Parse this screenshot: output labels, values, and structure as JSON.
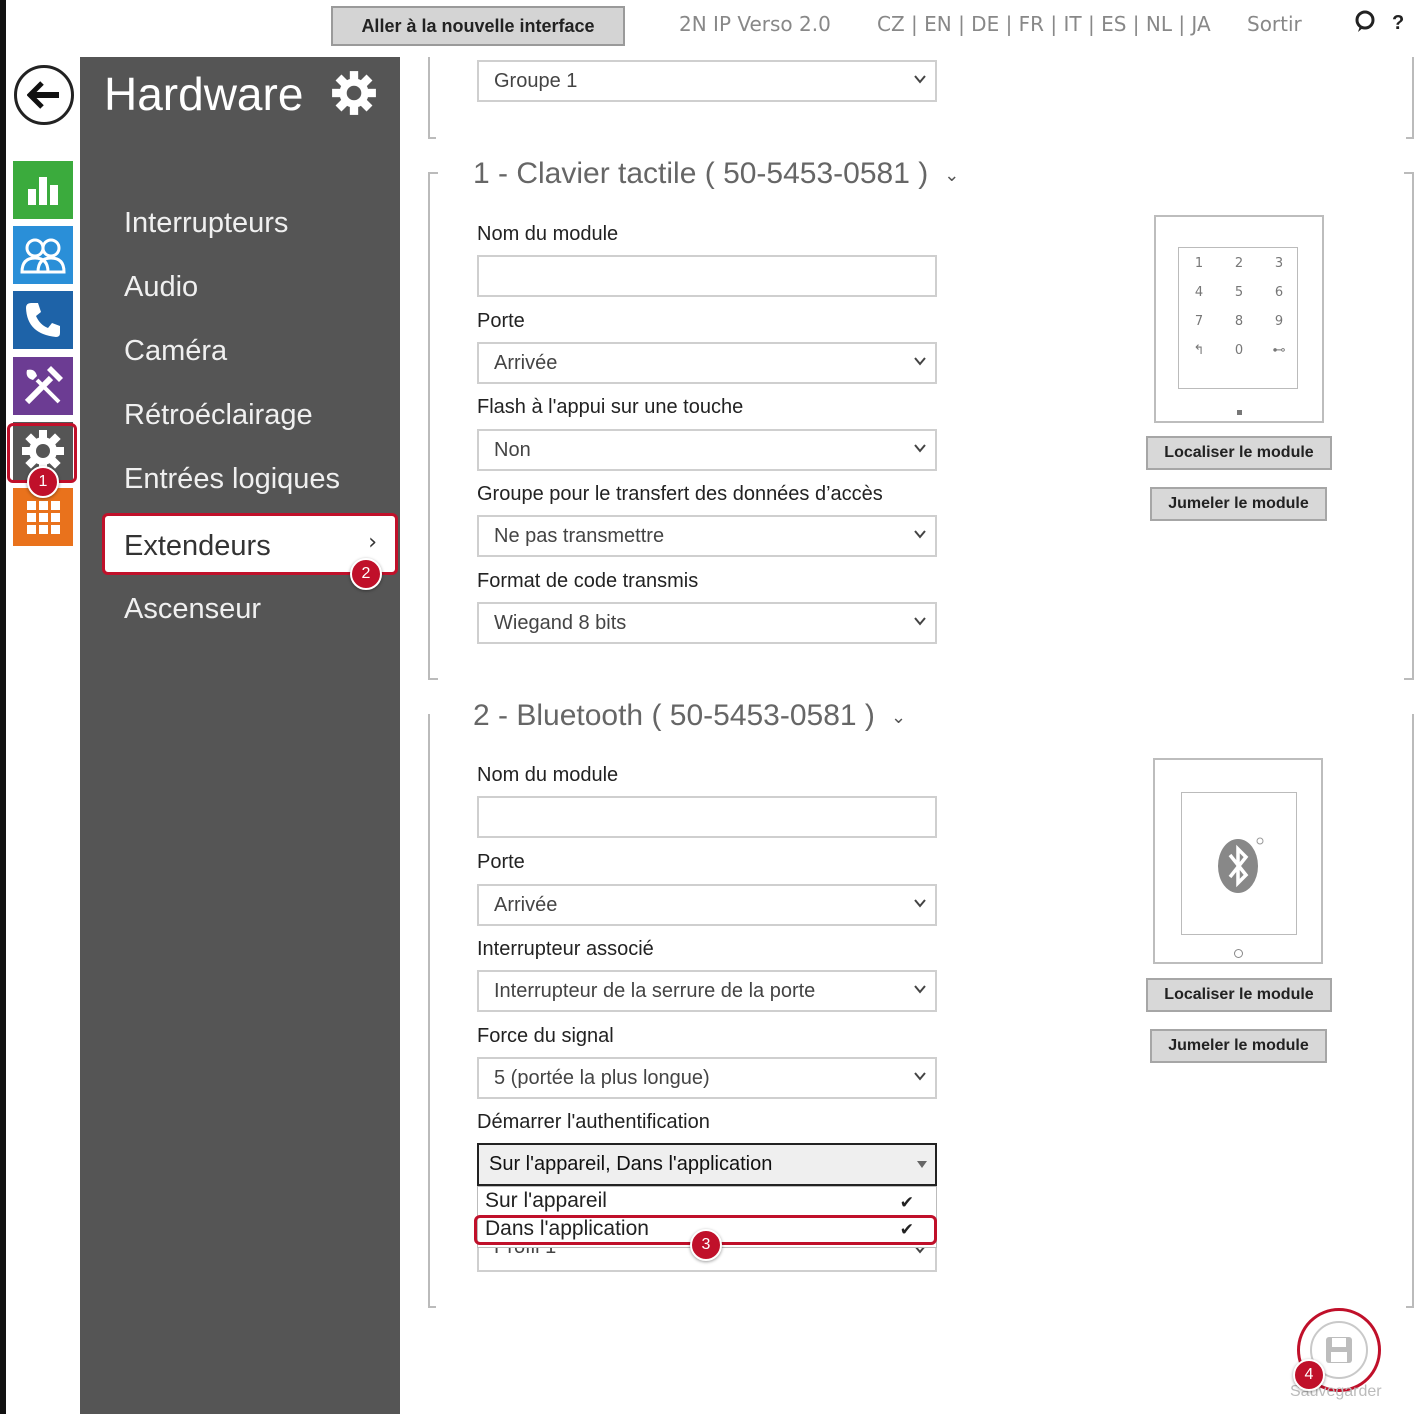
{
  "topbar": {
    "new_ui_label": "Aller à la nouvelle interface",
    "device_name": "2N IP Verso 2.0",
    "languages": "CZ | EN | DE | FR | IT | ES | NL | JA",
    "logout": "Sortir",
    "help": "?"
  },
  "iconbar": {
    "tiles": [
      "status-icon",
      "directory-icon",
      "phone-icon",
      "services-icon",
      "hardware-icon",
      "system-icon"
    ]
  },
  "sidebar": {
    "title": "Hardware",
    "items": [
      {
        "label": "Interrupteurs"
      },
      {
        "label": "Audio"
      },
      {
        "label": "Caméra"
      },
      {
        "label": "Rétroéclairage"
      },
      {
        "label": "Entrées logiques"
      },
      {
        "label": "Extendeurs"
      },
      {
        "label": "Ascenseur"
      }
    ]
  },
  "badges": {
    "b1": "1",
    "b2": "2",
    "b3": "3",
    "b4": "4"
  },
  "top_select": {
    "value": "Groupe 1"
  },
  "module1": {
    "title": "1 - Clavier tactile ( 50-5453-0581 )",
    "name_label": "Nom du module",
    "name_value": "",
    "door_label": "Porte",
    "door_value": "Arrivée",
    "flash_label": "Flash à l'appui sur une touche",
    "flash_value": "Non",
    "group_label": "Groupe pour le transfert des données d’accès",
    "group_value": "Ne pas transmettre",
    "format_label": "Format de code transmis",
    "format_value": "Wiegand 8 bits",
    "keypad_keys": [
      "1",
      "2",
      "3",
      "4",
      "5",
      "6",
      "7",
      "8",
      "9",
      "↰",
      "0",
      "⊷"
    ],
    "locate_btn": "Localiser le module",
    "pair_btn": "Jumeler le module"
  },
  "module2": {
    "title": "2 - Bluetooth ( 50-5453-0581 )",
    "name_label": "Nom du module",
    "name_value": "",
    "door_label": "Porte",
    "door_value": "Arrivée",
    "switch_label": "Interrupteur associé",
    "switch_value": "Interrupteur de la serrure de la porte",
    "signal_label": "Force du signal",
    "signal_value": "5 (portée la plus longue)",
    "auth_label": "Démarrer l'authentification",
    "auth_value": "Sur l'appareil, Dans l'application",
    "auth_options": [
      {
        "label": "Sur l'appareil",
        "checked": "✔"
      },
      {
        "label": "Dans l'application",
        "checked": "✔"
      }
    ],
    "profile_value": "Profil 1",
    "locate_btn": "Localiser le module",
    "pair_btn": "Jumeler le module"
  },
  "save": {
    "label": "Sauvegarder"
  },
  "colors": {
    "accent_red": "#c0102a",
    "sidebar_bg": "#555555"
  }
}
